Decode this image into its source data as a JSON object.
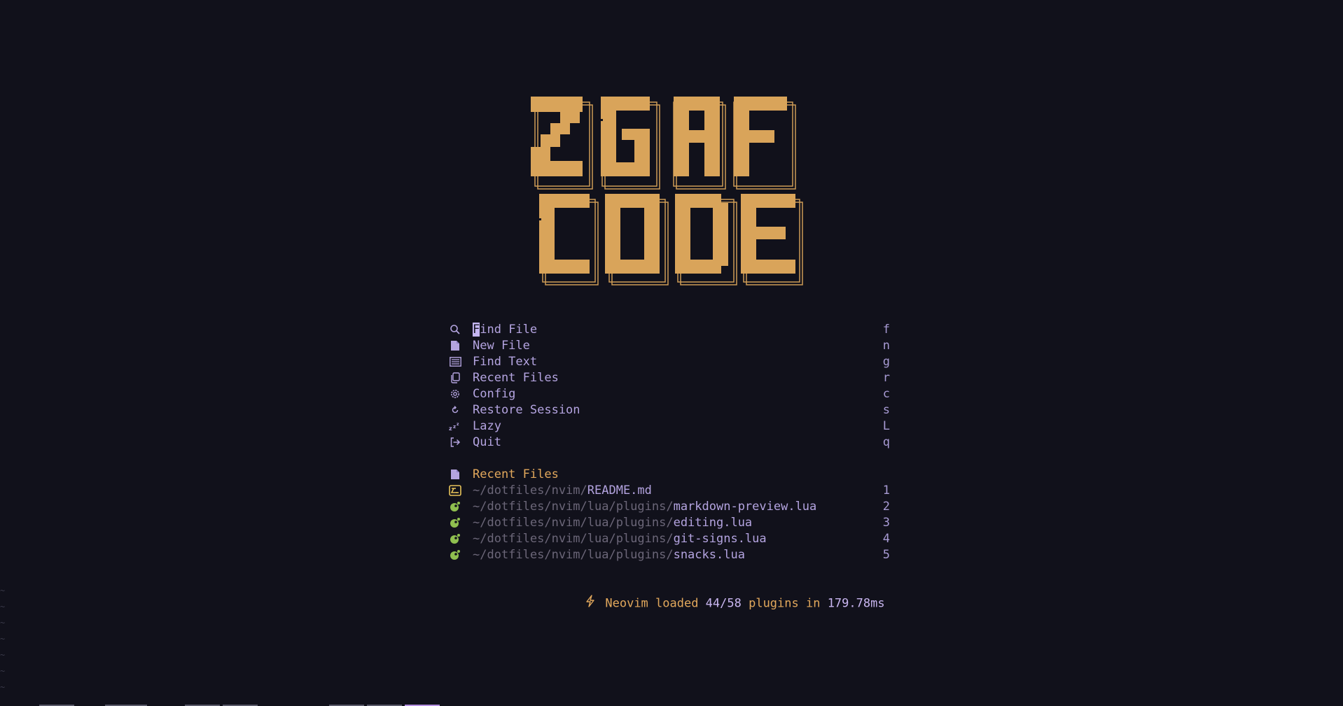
{
  "logo": {
    "text": "ZGAF CODE",
    "line1": [
      "Z",
      "G",
      "A",
      "F"
    ],
    "line2": [
      "C",
      "O",
      "D",
      "E"
    ],
    "color": "#d9a45a"
  },
  "menu": [
    {
      "label": "Find File",
      "key": "f",
      "icon": "search-icon"
    },
    {
      "label": "New File",
      "key": "n",
      "icon": "file-icon"
    },
    {
      "label": "Find Text",
      "key": "g",
      "icon": "text-search-icon"
    },
    {
      "label": "Recent Files",
      "key": "r",
      "icon": "copy-icon"
    },
    {
      "label": "Config",
      "key": "c",
      "icon": "gear-icon"
    },
    {
      "label": "Restore Session",
      "key": "s",
      "icon": "restore-icon"
    },
    {
      "label": "Lazy",
      "key": "L",
      "icon": "sleep-icon"
    },
    {
      "label": "Quit",
      "key": "q",
      "icon": "exit-icon"
    }
  ],
  "recent": {
    "title": "Recent Files",
    "files": [
      {
        "dir": "~/dotfiles/nvim/",
        "name": "README.md",
        "key": "1",
        "icon": "markdown-icon"
      },
      {
        "dir": "~/dotfiles/nvim/lua/plugins/",
        "name": "markdown-preview.lua",
        "key": "2",
        "icon": "lua-icon"
      },
      {
        "dir": "~/dotfiles/nvim/lua/plugins/",
        "name": "editing.lua",
        "key": "3",
        "icon": "lua-icon"
      },
      {
        "dir": "~/dotfiles/nvim/lua/plugins/",
        "name": "git-signs.lua",
        "key": "4",
        "icon": "lua-icon"
      },
      {
        "dir": "~/dotfiles/nvim/lua/plugins/",
        "name": "snacks.lua",
        "key": "5",
        "icon": "lua-icon"
      }
    ]
  },
  "footer": {
    "prefix": "Neovim loaded ",
    "loaded": "44/58",
    "middle": " plugins in ",
    "time": "179.78ms",
    "icon": "lightning-icon"
  },
  "colors": {
    "background": "#11111b",
    "accent": "#e2a85c",
    "label": "#b4a4e0",
    "dim": "#6b6678",
    "lua": "#8fbf4f"
  }
}
